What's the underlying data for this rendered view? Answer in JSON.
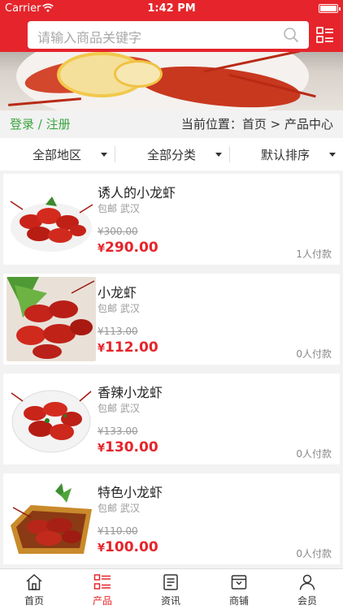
{
  "status": {
    "carrier": "Carrier",
    "time": "1:42 PM"
  },
  "search": {
    "placeholder": "请输入商品关键字"
  },
  "breadcrumb": {
    "login": "登录",
    "separator": "/",
    "register": "注册",
    "location_prefix": "当前位置：",
    "home": "首页",
    "arrow": ">",
    "current": "产品中心"
  },
  "filters": [
    {
      "label": "全部地区"
    },
    {
      "label": "全部分类"
    },
    {
      "label": "默认排序"
    }
  ],
  "products": [
    {
      "name": "诱人的小龙虾",
      "tags": "包邮 武汉",
      "old_price": "¥300.00",
      "currency": "¥",
      "price": "290.00",
      "payers": "1人付款"
    },
    {
      "name": "小龙虾",
      "tags": "包邮 武汉",
      "old_price": "¥113.00",
      "currency": "¥",
      "price": "112.00",
      "payers": "0人付款"
    },
    {
      "name": "香辣小龙虾",
      "tags": "包邮 武汉",
      "old_price": "¥133.00",
      "currency": "¥",
      "price": "130.00",
      "payers": "0人付款"
    },
    {
      "name": "特色小龙虾",
      "tags": "包邮 武汉",
      "old_price": "¥110.00",
      "currency": "¥",
      "price": "100.00",
      "payers": "0人付款"
    }
  ],
  "tabbar": [
    {
      "label": "首页",
      "icon": "home-icon",
      "active": false
    },
    {
      "label": "产品",
      "icon": "list-icon",
      "active": true
    },
    {
      "label": "资讯",
      "icon": "news-icon",
      "active": false
    },
    {
      "label": "商铺",
      "icon": "store-icon",
      "active": false
    },
    {
      "label": "会员",
      "icon": "user-icon",
      "active": false
    }
  ],
  "colors": {
    "brand_red": "#e5252b",
    "login_green": "#3aa53f"
  }
}
